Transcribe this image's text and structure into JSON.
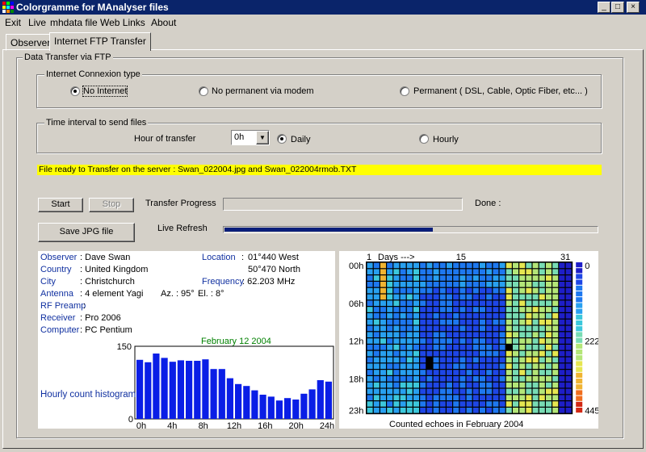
{
  "window": {
    "title": "Colorgramme for MAnalyser files",
    "minimize": "_",
    "maximize": "□",
    "close": "×"
  },
  "menu": [
    "Exit",
    "Live",
    "mhdata file",
    "Web Links",
    "About"
  ],
  "tabs": [
    "Observer",
    "Internet FTP Transfer"
  ],
  "ftp": {
    "group_title": "Data Transfer via FTP",
    "connexion": {
      "title": "Internet Connexion type",
      "options": [
        "No Internet",
        "No permanent via modem",
        "Permanent ( DSL, Cable, Optic Fiber, etc... )"
      ],
      "selected": 0
    },
    "interval": {
      "title": "Time interval to send files",
      "hour_label": "Hour of transfer",
      "hour_value": "0h",
      "options": [
        "Daily",
        "Hourly"
      ],
      "selected": 0
    },
    "status_message": "File ready to Transfer on the server : Swan_022004.jpg  and  Swan_022004rmob.TXT",
    "start_label": "Start",
    "stop_label": "Stop",
    "progress_label": "Transfer Progress",
    "done_label": "Done :",
    "save_label": "Save JPG file",
    "live_refresh_label": "Live Refresh",
    "live_refresh_progress": 0.56
  },
  "observer_info": {
    "observer_label": "Observer",
    "observer": "Dave Swan",
    "country_label": "Country",
    "country": "United Kingdom",
    "city_label": "City",
    "city": "Christchurch",
    "antenna_label": "Antenna",
    "antenna": "4 element Yagi",
    "azimuth": "Az. : 95°",
    "elevation": "El. : 8°",
    "rf_preamp_label": "RF Preamp",
    "receiver_label": "Receiver",
    "receiver": "Pro 2006",
    "computer_label": "Computer",
    "computer": "PC Pentium",
    "location_label": "Location",
    "longitude": "01°440 West",
    "latitude": "50°470 North",
    "frequency_label": "Frequency",
    "frequency": "62.203 MHz"
  },
  "chart_data": [
    {
      "type": "bar",
      "title": "February 12 2004",
      "side_label": "Hourly count histogram",
      "y_max_label": "150",
      "y_min_label": "0",
      "ylim": [
        0,
        150
      ],
      "dashed_ref": 150,
      "x_tick_labels": [
        "0h",
        "4h",
        "8h",
        "12h",
        "16h",
        "20h",
        "24h"
      ],
      "values": [
        122,
        117,
        135,
        126,
        118,
        121,
        120,
        120,
        123,
        103,
        103,
        84,
        72,
        68,
        59,
        50,
        46,
        38,
        43,
        40,
        52,
        61,
        80,
        77
      ],
      "color": "#0a1ee6"
    },
    {
      "type": "heatmap",
      "title": "Counted echoes in February 2004",
      "top_labels": [
        "1",
        "Days --->",
        "15",
        "31"
      ],
      "hour_labels": [
        "00h",
        "06h",
        "12h",
        "18h",
        "23h"
      ],
      "scale_labels": [
        "0",
        "222",
        "445"
      ],
      "days": 31,
      "hours": 24,
      "filled_days": 29,
      "scale": [
        0,
        445
      ]
    }
  ]
}
